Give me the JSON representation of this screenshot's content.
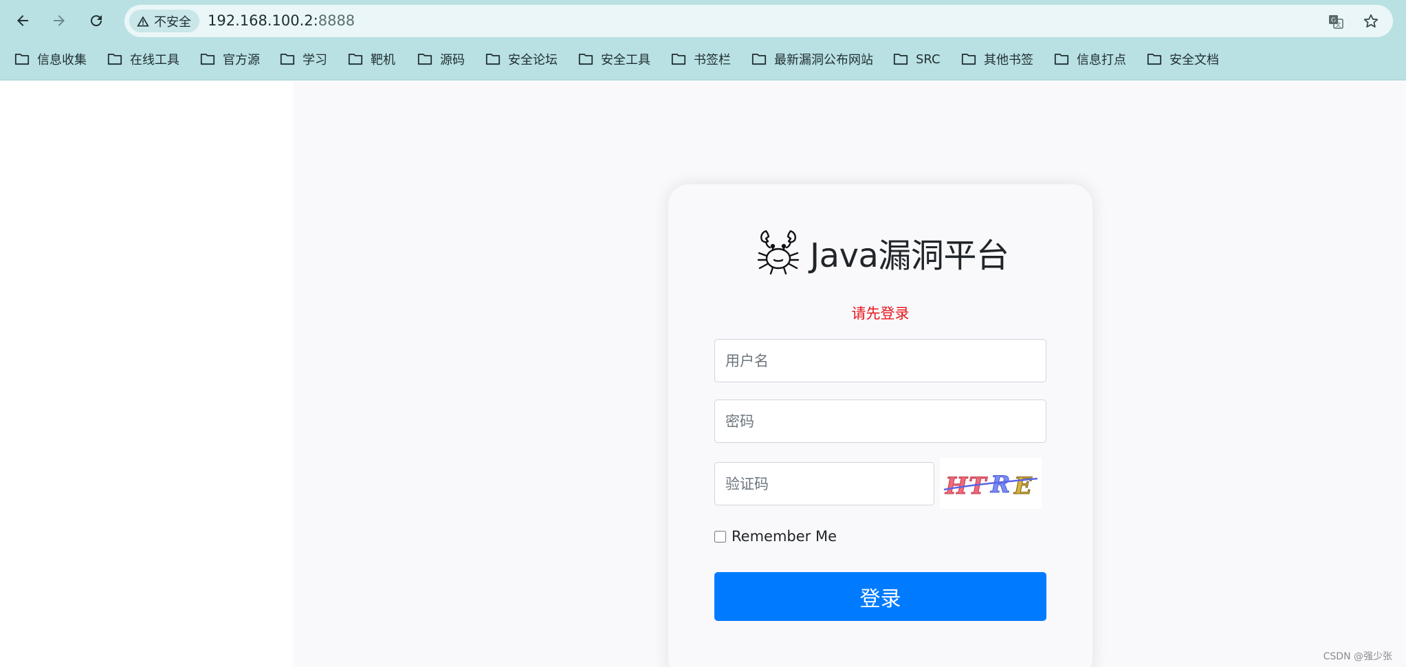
{
  "browser": {
    "security_label": "不安全",
    "url_host": "192.168.100.2:",
    "url_port": "8888",
    "bookmarks": [
      "信息收集",
      "在线工具",
      "官方源",
      "学习",
      "靶机",
      "源码",
      "安全论坛",
      "安全工具",
      "书签栏",
      "最新漏洞公布网站",
      "SRC",
      "其他书签",
      "信息打点",
      "安全文档"
    ]
  },
  "login": {
    "title": "Java漏洞平台",
    "alert": "请先登录",
    "username_placeholder": "用户名",
    "password_placeholder": "密码",
    "captcha_placeholder": "验证码",
    "captcha_text": "HTRE",
    "remember_label": "Remember Me",
    "submit_label": "登录"
  },
  "watermark": "CSDN @强少张",
  "colors": {
    "chrome_bg": "#b9e1e4",
    "primary": "#007bff",
    "alert": "#e5171b"
  }
}
